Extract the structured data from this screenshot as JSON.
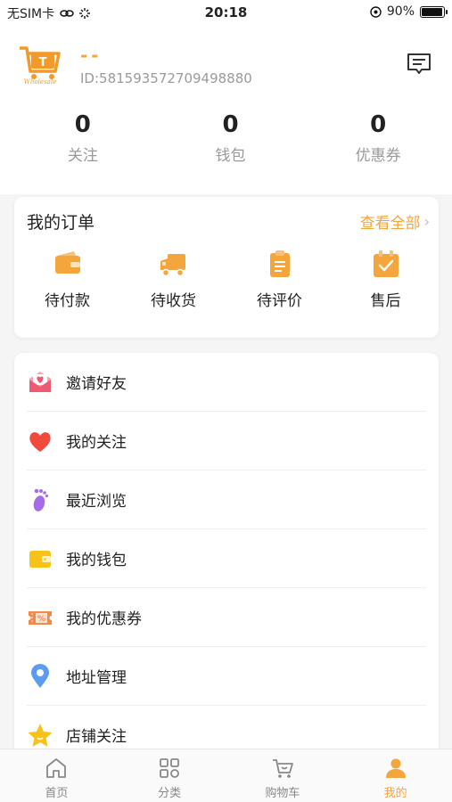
{
  "status_bar": {
    "carrier": "无SIM卡",
    "time": "20:18",
    "battery": "90%"
  },
  "profile": {
    "logo_text": "Wholesale",
    "name": "--",
    "id": "ID:581593572709498880",
    "message_icon": "message-icon"
  },
  "stats": [
    {
      "value": "0",
      "label": "关注"
    },
    {
      "value": "0",
      "label": "钱包"
    },
    {
      "value": "0",
      "label": "优惠券"
    }
  ],
  "orders": {
    "title": "我的订单",
    "view_all": "查看全部",
    "items": [
      {
        "label": "待付款",
        "icon": "wallet-icon"
      },
      {
        "label": "待收货",
        "icon": "truck-icon"
      },
      {
        "label": "待评价",
        "icon": "clipboard-icon"
      },
      {
        "label": "售后",
        "icon": "checkbox-icon"
      }
    ]
  },
  "menu": [
    {
      "label": "邀请好友",
      "icon": "envelope-heart-icon"
    },
    {
      "label": "我的关注",
      "icon": "heart-icon"
    },
    {
      "label": "最近浏览",
      "icon": "footprint-icon"
    },
    {
      "label": "我的钱包",
      "icon": "wallet-icon"
    },
    {
      "label": "我的优惠券",
      "icon": "coupon-icon"
    },
    {
      "label": "地址管理",
      "icon": "location-pin-icon"
    },
    {
      "label": "店铺关注",
      "icon": "star-icon"
    }
  ],
  "tabbar": [
    {
      "label": "首页",
      "icon": "home-icon",
      "active": false
    },
    {
      "label": "分类",
      "icon": "grid-icon",
      "active": false
    },
    {
      "label": "购物车",
      "icon": "cart-icon",
      "active": false
    },
    {
      "label": "我的",
      "icon": "user-icon",
      "active": true
    }
  ],
  "colors": {
    "accent": "#f4a53c",
    "muted": "#9a9a9a"
  }
}
